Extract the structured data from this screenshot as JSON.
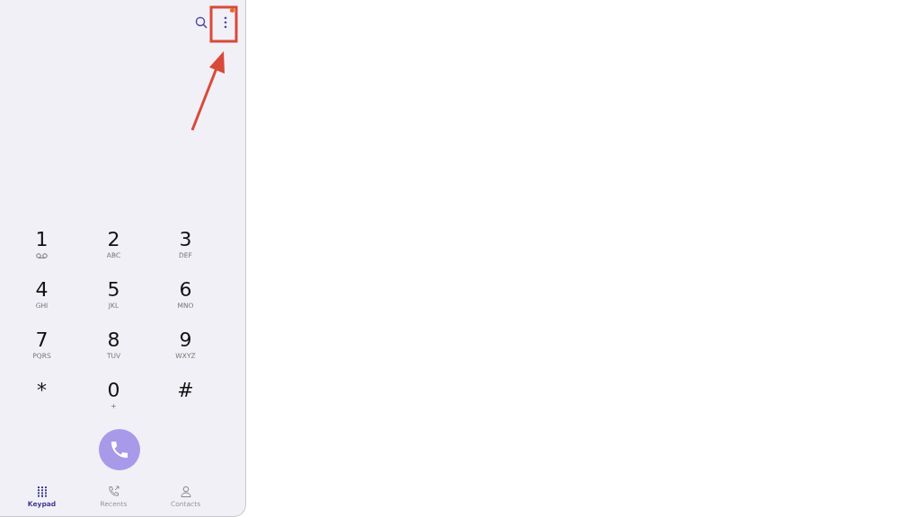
{
  "toolbar": {
    "menu_notification": true
  },
  "keys": [
    {
      "digit": "1",
      "kind": "voicemail"
    },
    {
      "digit": "2",
      "letters": "ABC",
      "kind": "letters"
    },
    {
      "digit": "3",
      "letters": "DEF",
      "kind": "letters"
    },
    {
      "digit": "4",
      "letters": "GHI",
      "kind": "letters"
    },
    {
      "digit": "5",
      "letters": "JKL",
      "kind": "letters"
    },
    {
      "digit": "6",
      "letters": "MNO",
      "kind": "letters"
    },
    {
      "digit": "7",
      "letters": "PQRS",
      "kind": "letters"
    },
    {
      "digit": "8",
      "letters": "TUV",
      "kind": "letters"
    },
    {
      "digit": "9",
      "letters": "WXYZ",
      "kind": "letters"
    },
    {
      "digit": "*",
      "kind": "plain"
    },
    {
      "digit": "0",
      "letters": "+",
      "kind": "letters"
    },
    {
      "digit": "#",
      "kind": "plain"
    }
  ],
  "tabs": [
    {
      "label": "Keypad",
      "kind": "keypad",
      "selected": true
    },
    {
      "label": "Recents",
      "kind": "recents",
      "selected": false
    },
    {
      "label": "Contacts",
      "kind": "contacts",
      "selected": false
    }
  ]
}
